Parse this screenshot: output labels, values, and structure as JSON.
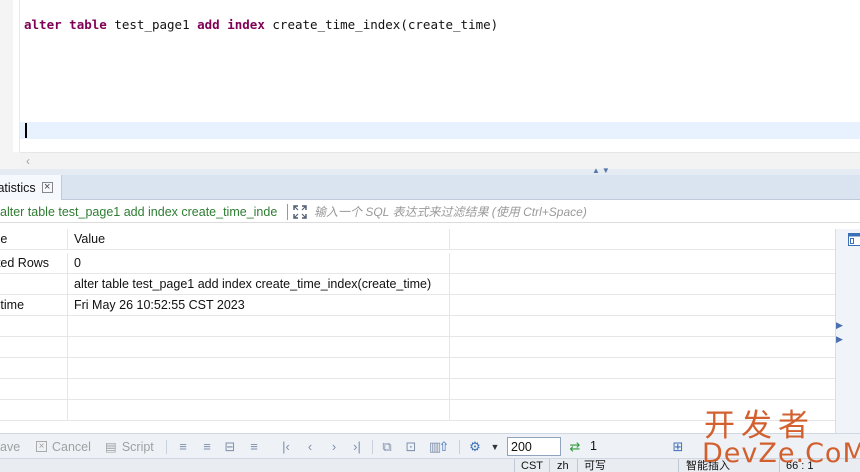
{
  "editor": {
    "code_tokens": [
      {
        "text": "alter",
        "kind": "kw"
      },
      {
        "text": " ",
        "kind": "plain"
      },
      {
        "text": "table",
        "kind": "kw"
      },
      {
        "text": " test_page1 ",
        "kind": "plain"
      },
      {
        "text": "add",
        "kind": "kw"
      },
      {
        "text": " ",
        "kind": "plain"
      },
      {
        "text": "index",
        "kind": "kw"
      },
      {
        "text": " create_time_index(create_time)",
        "kind": "plain"
      }
    ]
  },
  "results_tab": {
    "label": "tatistics"
  },
  "filter": {
    "query_text": "alter table test_page1 add index create_time_inde",
    "placeholder": "输入一个 SQL 表达式来过滤结果 (使用 Ctrl+Space)"
  },
  "grid": {
    "headers": [
      "me",
      "Value",
      ""
    ],
    "rows": [
      [
        "ated Rows",
        "0",
        ""
      ],
      [
        "",
        "alter table test_page1 add index create_time_index(create_time)",
        ""
      ],
      [
        "h time",
        "Fri May 26 10:52:55 CST 2023",
        ""
      ],
      [
        "",
        "",
        ""
      ],
      [
        "",
        "",
        ""
      ],
      [
        "",
        "",
        ""
      ],
      [
        "",
        "",
        ""
      ],
      [
        "",
        "",
        ""
      ]
    ]
  },
  "toolbar": {
    "save_label": "ave",
    "cancel_label": "Cancel",
    "script_label": "Script",
    "fetch_size": "200",
    "row_count": "1"
  },
  "statusbar": {
    "timezone": "CST",
    "locale": "zh",
    "mode": "可写",
    "insert_mode": "智能插入",
    "position": "66 : 1"
  },
  "watermark": {
    "line1": "开发者",
    "line2": "DevZe.CoM"
  },
  "colors": {
    "keyword": "#7f0055",
    "query_text": "#2e7d32",
    "accent": "#3b6fb6",
    "watermark": "#d0541f"
  }
}
